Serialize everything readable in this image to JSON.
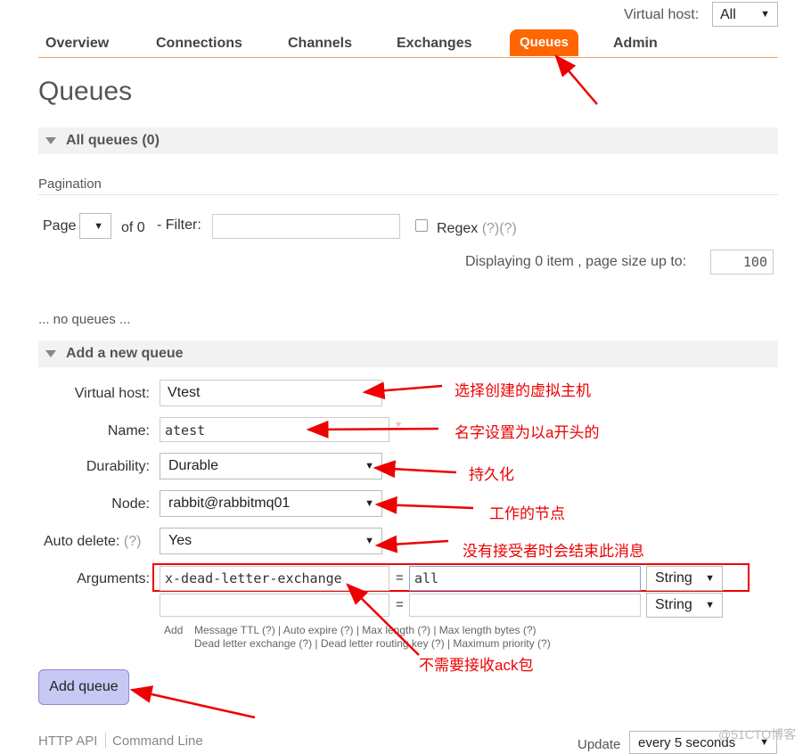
{
  "header": {
    "vhost_label": "Virtual host:",
    "vhost_value": "All"
  },
  "nav": {
    "overview": "Overview",
    "connections": "Connections",
    "channels": "Channels",
    "exchanges": "Exchanges",
    "queues": "Queues",
    "admin": "Admin"
  },
  "page_title": "Queues",
  "all_queues": {
    "title": "All queues (0)"
  },
  "pagination": {
    "heading": "Pagination",
    "page_label": "Page",
    "page_of": "of 0",
    "filter_label": "- Filter:",
    "filter_value": "",
    "regex_label": "Regex",
    "regex_help": "(?)(?)",
    "displaying": "Displaying 0 item , page size up to:",
    "page_size": "100"
  },
  "no_queues": "... no queues ...",
  "add_queue": {
    "title": "Add a new queue",
    "virtual_host_label": "Virtual host:",
    "virtual_host_value": "Vtest",
    "name_label": "Name:",
    "name_value": "atest",
    "name_required": "*",
    "durability_label": "Durability:",
    "durability_value": "Durable",
    "node_label": "Node:",
    "node_value": "rabbit@rabbitmq01",
    "auto_delete_label": "Auto delete:",
    "auto_delete_help": "(?)",
    "auto_delete_value": "Yes",
    "arguments_label": "Arguments:",
    "arguments": [
      {
        "key": "x-dead-letter-exchange",
        "eq": "=",
        "value": "all",
        "type": "String"
      },
      {
        "key": "",
        "eq": "=",
        "value": "",
        "type": "String"
      }
    ],
    "add_label": "Add",
    "helper_line1": "Message TTL (?) | Auto expire (?) | Max length (?) | Max length bytes (?)",
    "helper_line2": "Dead letter exchange (?) | Dead letter routing key (?) | Maximum priority (?)",
    "submit": "Add queue"
  },
  "footer": {
    "http_api": "HTTP API",
    "command_line": "Command Line",
    "update_label": "Update",
    "update_value": "every 5 seconds"
  },
  "annotations": {
    "vhost": "选择创建的虚拟主机",
    "name": "名字设置为以a开头的",
    "durability": "持久化",
    "node": "工作的节点",
    "auto_delete": "没有接受者时会结束此消息",
    "arguments": "不需要接收ack包"
  },
  "watermark": "@51CTO博客",
  "colors": {
    "nav_active": "#ff6600",
    "annotation": "#ee0000",
    "button": "#c8c8f4"
  }
}
